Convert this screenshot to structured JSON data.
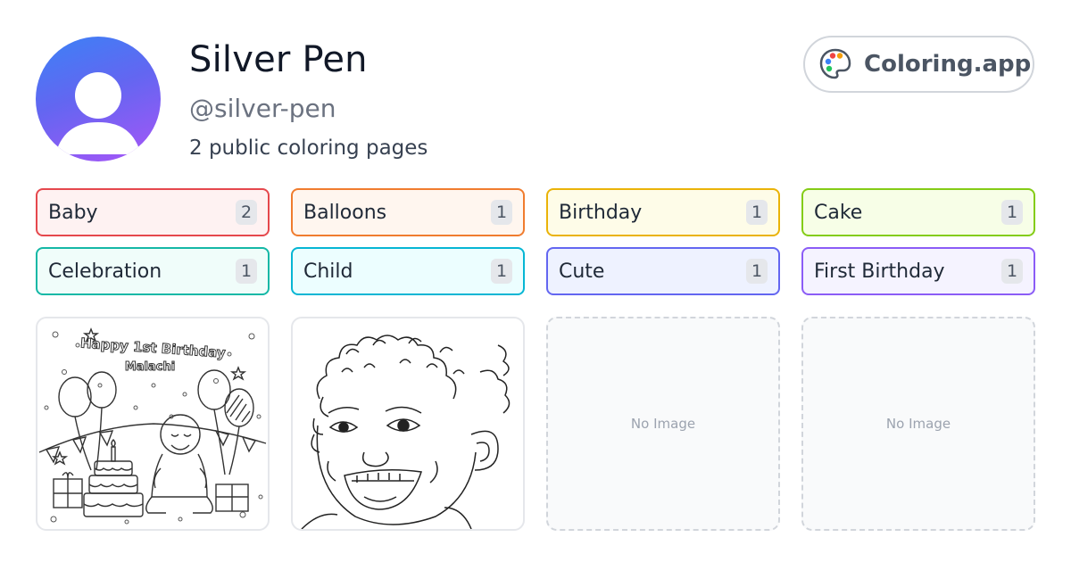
{
  "profile": {
    "name": "Silver Pen",
    "handle": "@silver-pen",
    "count_text": "2 public coloring pages",
    "avatar_icon": "user-silhouette-icon"
  },
  "brand": {
    "label": "Coloring.app",
    "icon": "palette-icon"
  },
  "tags": [
    {
      "label": "Baby",
      "count": "2",
      "color": "#e5484d",
      "bg": "#fef2f2"
    },
    {
      "label": "Balloons",
      "count": "1",
      "color": "#f07c2e",
      "bg": "#fff6ef"
    },
    {
      "label": "Birthday",
      "count": "1",
      "color": "#eab308",
      "bg": "#fefce8"
    },
    {
      "label": "Cake",
      "count": "1",
      "color": "#84cc16",
      "bg": "#f7fee7"
    },
    {
      "label": "Celebration",
      "count": "1",
      "color": "#14b8a6",
      "bg": "#f0fdfa"
    },
    {
      "label": "Child",
      "count": "1",
      "color": "#06b6d4",
      "bg": "#ecfeff"
    },
    {
      "label": "Cute",
      "count": "1",
      "color": "#6366f1",
      "bg": "#eef2ff"
    },
    {
      "label": "First Birthday",
      "count": "1",
      "color": "#8b5cf6",
      "bg": "#f5f3ff"
    }
  ],
  "cards": [
    {
      "kind": "image",
      "banner_line1": "Happy 1st Birthday",
      "banner_line2": "Malachi"
    },
    {
      "kind": "image"
    },
    {
      "kind": "empty",
      "label": "No Image"
    },
    {
      "kind": "empty",
      "label": "No Image"
    }
  ]
}
